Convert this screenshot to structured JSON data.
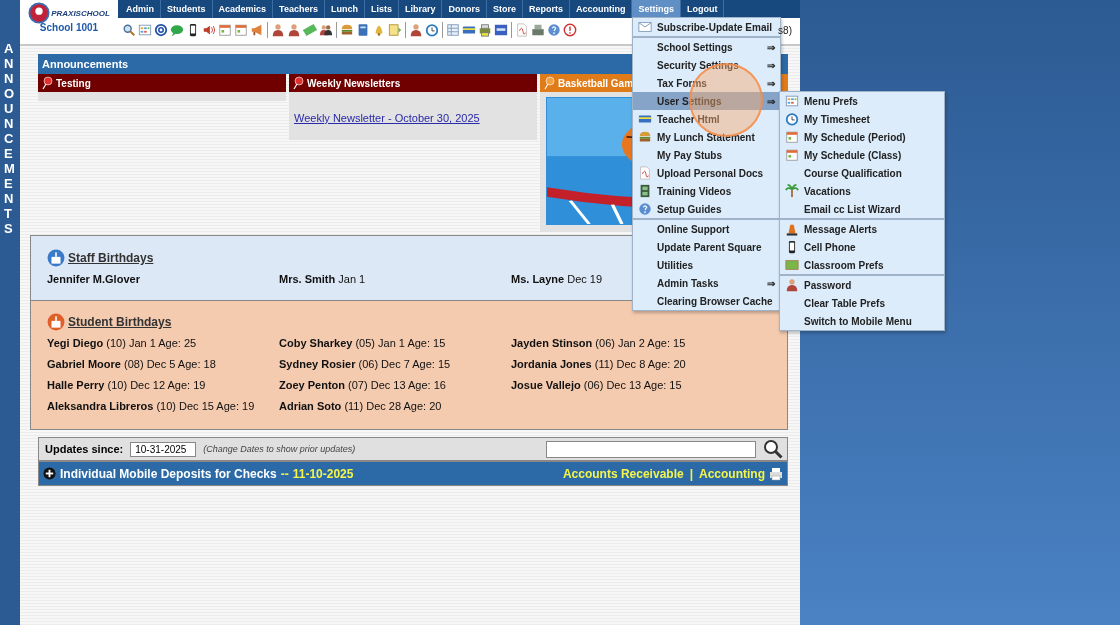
{
  "side_banner": {
    "text": "ANNOUNCEMENTS"
  },
  "logo": {
    "brand": "PRAXISCHOOL",
    "school": "School 1001"
  },
  "nav": [
    {
      "label": "Admin",
      "selected": false
    },
    {
      "label": "Students",
      "selected": false
    },
    {
      "label": "Academics",
      "selected": false
    },
    {
      "label": "Teachers",
      "selected": false
    },
    {
      "label": "Lunch",
      "selected": false
    },
    {
      "label": "Lists",
      "selected": false
    },
    {
      "label": "Library",
      "selected": false
    },
    {
      "label": "Donors",
      "selected": false
    },
    {
      "label": "Store",
      "selected": false
    },
    {
      "label": "Reports",
      "selected": false
    },
    {
      "label": "Accounting",
      "selected": false
    },
    {
      "label": "Settings",
      "selected": true
    },
    {
      "label": "Logout",
      "selected": false
    }
  ],
  "header_note": "s8)",
  "announcements": {
    "title": "Announcements",
    "columns": [
      {
        "title": "Testing",
        "color": "#700000",
        "kind": "empty"
      },
      {
        "title": "Weekly Newsletters",
        "color": "#700000",
        "kind": "links",
        "links": [
          "Weekly Newsletter - October 30, 2025"
        ]
      },
      {
        "title": "Basketball Gam",
        "color": "#e07b1a",
        "kind": "picture"
      }
    ]
  },
  "staff_birthdays": {
    "title": "Staff Birthdays",
    "people": [
      "**Jennifer M.Glover**",
      "**Mrs. Smith** Jan 1",
      "**Ms. Layne** Dec 19"
    ]
  },
  "student_birthdays": {
    "title": "Student Birthdays",
    "people": [
      "**Yegi Diego** (10) Jan 1 Age: 25",
      "**Coby Sharkey** (05) Jan 1 Age: 15",
      "**Jayden Stinson** (06) Jan 2 Age: 15",
      "**Gabriel Moore** (08) Dec 5 Age: 18",
      "**Sydney Rosier** (06) Dec 7 Age: 15",
      "**Jordania Jones** (11) Dec 8 Age: 20",
      "**Halle Perry** (10) Dec 12 Age: 19",
      "**Zoey Penton** (07) Dec 13 Age: 16",
      "**Josue Vallejo** (06) Dec 13 Age: 15",
      "**Aleksandra Libreros** (10) Dec 15 Age: 19",
      "**Adrian Soto** (11) Dec 28 Age: 20"
    ]
  },
  "updates": {
    "label": "Updates since:",
    "date": "10-31-2025",
    "hint": "(Change Dates to show prior updates)"
  },
  "feed": [
    {
      "title": "Individual Mobile Deposits for Checks",
      "separator": "--",
      "date": "11-10-2025",
      "expanded": false,
      "links": [
        "Accounts Receivable",
        "|",
        "Accounting"
      ]
    }
  ],
  "settings_menu": {
    "sections": [
      {
        "items": [
          {
            "label": "Subscribe-Update Email",
            "selected": false
          }
        ]
      },
      {
        "items": [
          {
            "label": "School Settings",
            "arrow": "⇒",
            "selected": false
          },
          {
            "label": "Security Settings",
            "arrow": "⇒",
            "selected": false
          },
          {
            "label": "Tax Forms",
            "arrow": "⇒",
            "selected": false
          },
          {
            "label": "User Settings",
            "arrow": "⇒",
            "selected": true
          },
          {
            "label": "Teacher Html",
            "selected": false
          },
          {
            "label": "My Lunch Statement",
            "selected": false
          },
          {
            "label": "My Pay Stubs",
            "selected": false
          },
          {
            "label": "Upload Personal Docs",
            "selected": false
          },
          {
            "label": "Training Videos",
            "selected": false
          },
          {
            "label": "Setup Guides",
            "selected": false
          }
        ]
      },
      {
        "items": [
          {
            "label": "Online Support",
            "selected": false
          },
          {
            "label": "Update Parent Square",
            "selected": false
          },
          {
            "label": "Utilities",
            "selected": false
          },
          {
            "label": "Admin Tasks",
            "arrow": "⇒",
            "selected": false
          },
          {
            "label": "Clearing Browser Cache",
            "selected": false
          }
        ]
      }
    ]
  },
  "user_settings_menu": {
    "sections": [
      {
        "items": [
          {
            "label": "Menu Prefs"
          },
          {
            "label": "My Timesheet"
          },
          {
            "label": "My Schedule (Period)"
          },
          {
            "label": "My Schedule (Class)"
          },
          {
            "label": "Course Qualification"
          },
          {
            "label": "Vacations"
          },
          {
            "label": "Email cc List Wizard"
          }
        ]
      },
      {
        "items": [
          {
            "label": "Message Alerts"
          },
          {
            "label": "Cell Phone"
          },
          {
            "label": "Classroom Prefs"
          }
        ]
      },
      {
        "items": [
          {
            "label": "Password"
          },
          {
            "label": "Clear Table Prefs"
          },
          {
            "label": "Switch to Mobile Menu"
          }
        ]
      }
    ]
  }
}
